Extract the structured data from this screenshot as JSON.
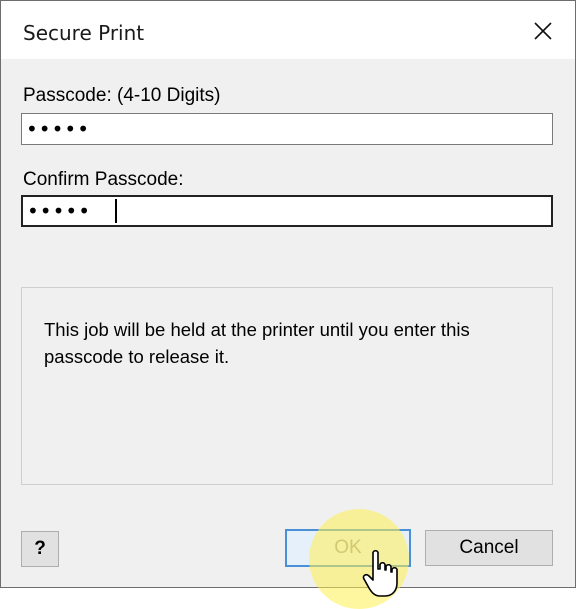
{
  "dialog": {
    "title": "Secure Print",
    "close_icon": "close-icon"
  },
  "passcode": {
    "label": "Passcode: (4-10 Digits)",
    "value": "•••••"
  },
  "confirm": {
    "label": "Confirm Passcode:",
    "value": "•••••"
  },
  "info": {
    "text": "This job will be held at the printer until you enter this passcode to release it."
  },
  "buttons": {
    "help": "?",
    "ok": "OK",
    "cancel": "Cancel"
  },
  "colors": {
    "focus_border": "#4a90d8",
    "highlight": "#fff050"
  }
}
